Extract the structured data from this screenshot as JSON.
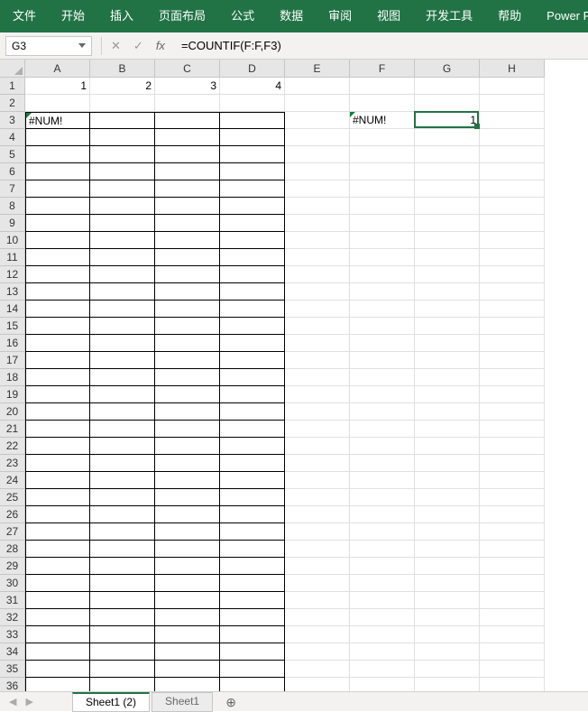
{
  "ribbon": {
    "tabs": [
      "文件",
      "开始",
      "插入",
      "页面布局",
      "公式",
      "数据",
      "审阅",
      "视图",
      "开发工具",
      "帮助",
      "Power Pivot"
    ]
  },
  "formula_bar": {
    "name_box": "G3",
    "formula": "=COUNTIF(F:F,F3)"
  },
  "columns": [
    "A",
    "B",
    "C",
    "D",
    "E",
    "F",
    "G",
    "H"
  ],
  "row_count": 36,
  "cells": {
    "A1": "1",
    "B1": "2",
    "C1": "3",
    "D1": "4",
    "A3": "#NUM!",
    "F3": "#NUM!",
    "G3": "1"
  },
  "selected_cell": "G3",
  "dark_border_range": {
    "rows": [
      3,
      36
    ],
    "cols": [
      "A",
      "D"
    ]
  },
  "sheet_tabs": {
    "active": "Sheet1 (2)",
    "other": "Sheet1"
  },
  "chart_data": {
    "type": "table",
    "title": "",
    "columns": [
      "A",
      "B",
      "C",
      "D",
      "E",
      "F",
      "G",
      "H"
    ],
    "rows": [
      {
        "row": 1,
        "A": 1,
        "B": 2,
        "C": 3,
        "D": 4
      },
      {
        "row": 3,
        "A": "#NUM!",
        "F": "#NUM!",
        "G": 1
      }
    ],
    "formula_cell": {
      "ref": "G3",
      "formula": "=COUNTIF(F:F,F3)",
      "value": 1
    }
  }
}
